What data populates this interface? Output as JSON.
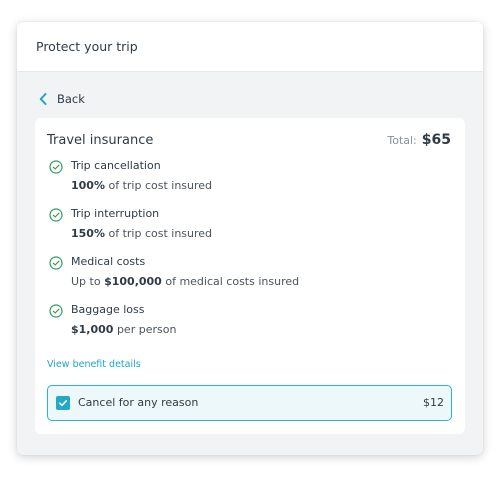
{
  "header": {
    "title": "Protect your trip"
  },
  "nav": {
    "back_label": "Back"
  },
  "insurance": {
    "title": "Travel insurance",
    "total_label": "Total:",
    "total_amount": "$65",
    "benefits": [
      {
        "name": "Trip cancellation",
        "desc_prefix": "",
        "desc_bold": "100%",
        "desc_suffix": " of trip cost insured"
      },
      {
        "name": "Trip interruption",
        "desc_prefix": "",
        "desc_bold": "150%",
        "desc_suffix": " of trip cost insured"
      },
      {
        "name": "Medical costs",
        "desc_prefix": "Up to ",
        "desc_bold": "$100,000",
        "desc_suffix": " of medical costs insured"
      },
      {
        "name": "Baggage loss",
        "desc_prefix": "",
        "desc_bold": "$1,000",
        "desc_suffix": " per person"
      }
    ],
    "details_link": "View benefit details",
    "addon": {
      "label": "Cancel for any reason",
      "price": "$12",
      "checked": true
    }
  },
  "icons": {
    "back": "chevron-left-icon",
    "benefit": "check-circle-icon",
    "addon": "checkbox-checked-icon"
  },
  "colors": {
    "accent": "#1aa7c6",
    "check_green": "#2e9e5b",
    "addon_border": "#2fb3c9",
    "addon_bg": "#edf8fb"
  }
}
